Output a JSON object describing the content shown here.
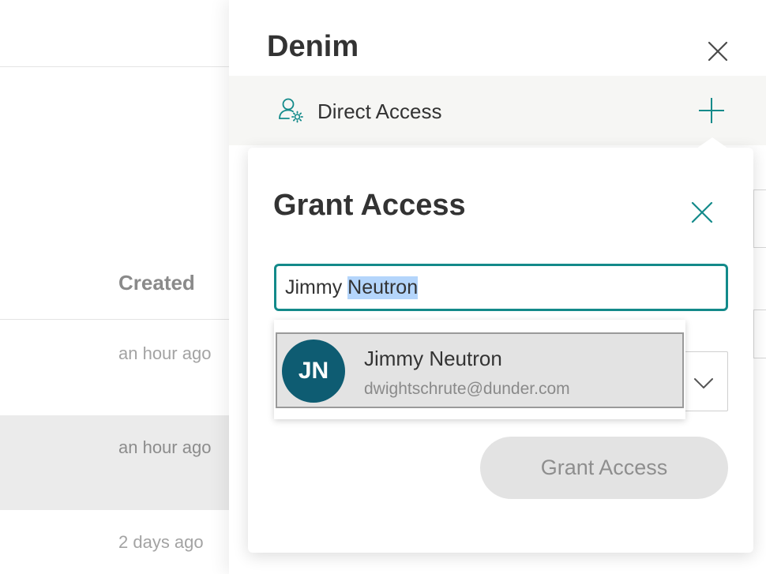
{
  "table": {
    "created_header": "Created",
    "rows": [
      {
        "created": "an hour ago"
      },
      {
        "created": "an hour ago"
      },
      {
        "created": "2 days ago"
      }
    ]
  },
  "drawer": {
    "title": "Denim",
    "section_label": "Direct Access",
    "icons": {
      "close": "close-icon",
      "section": "user-settings-icon",
      "add": "plus-icon"
    }
  },
  "grant_popover": {
    "title": "Grant Access",
    "search": {
      "typed_text": "Jimmy ",
      "highlighted_text": "Neutron"
    },
    "submit_label": "Grant Access",
    "submit_disabled": true,
    "suggestions": [
      {
        "initials": "JN",
        "name": "Jimmy Neutron",
        "email": "dwightschrute@dunder.com"
      }
    ]
  },
  "colors": {
    "accent": "#138a8a",
    "avatar": "#0e5c72",
    "selection": "#b4d5fb",
    "button_disabled_bg": "#e3e3e3",
    "button_disabled_text": "#8e8e8e"
  }
}
